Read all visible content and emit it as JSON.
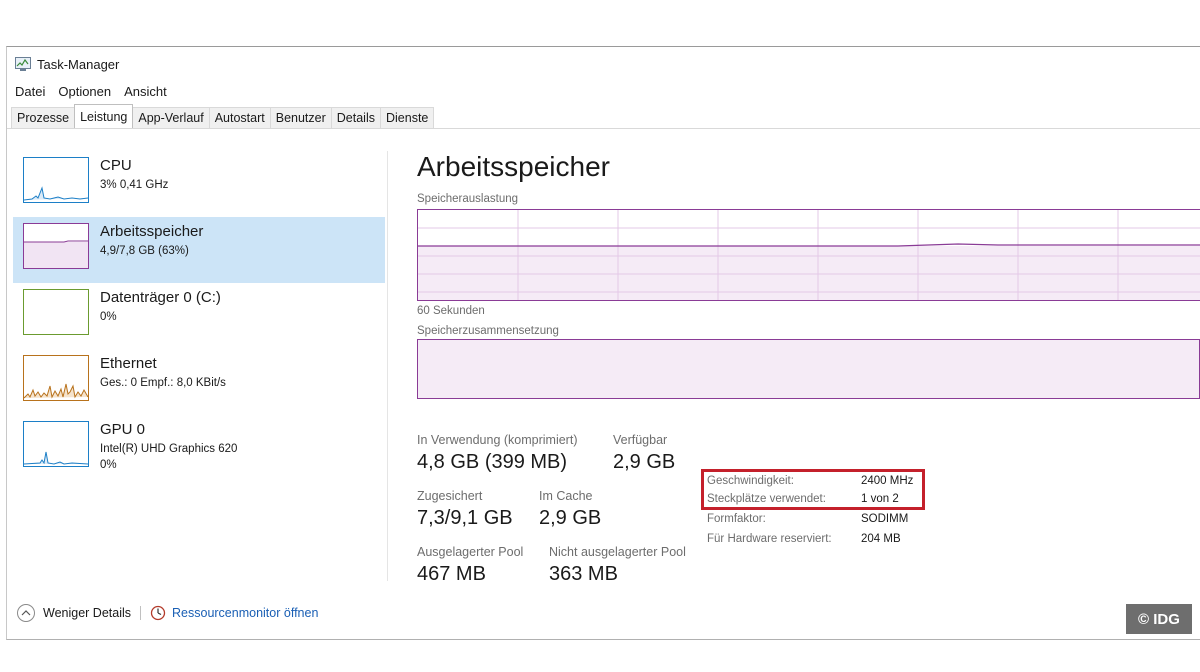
{
  "window": {
    "title": "Task-Manager"
  },
  "menu": [
    "Datei",
    "Optionen",
    "Ansicht"
  ],
  "tabs": [
    {
      "label": "Prozesse",
      "active": false
    },
    {
      "label": "Leistung",
      "active": true
    },
    {
      "label": "App-Verlauf",
      "active": false
    },
    {
      "label": "Autostart",
      "active": false
    },
    {
      "label": "Benutzer",
      "active": false
    },
    {
      "label": "Details",
      "active": false
    },
    {
      "label": "Dienste",
      "active": false
    }
  ],
  "sidebar": {
    "items": [
      {
        "title": "CPU",
        "sub": "3% 0,41 GHz",
        "color": "#1c7fc7",
        "selected": false
      },
      {
        "title": "Arbeitsspeicher",
        "sub": "4,9/7,8 GB (63%)",
        "color": "#8a3b96",
        "selected": true
      },
      {
        "title": "Datenträger 0 (C:)",
        "sub": "0%",
        "color": "#6b9b2f",
        "selected": false
      },
      {
        "title": "Ethernet",
        "sub": "Ges.: 0 Empf.: 8,0 KBit/s",
        "color": "#b8721c",
        "selected": false
      },
      {
        "title": "GPU 0",
        "sub": "Intel(R) UHD Graphics 620",
        "sub2": "0%",
        "color": "#1c7fc7",
        "selected": false
      }
    ]
  },
  "main": {
    "title": "Arbeitsspeicher",
    "usage_label": "Speicherauslastung",
    "time_label": "60 Sekunden",
    "composition_label": "Speicherzusammensetzung",
    "stats": {
      "in_use_label": "In Verwendung (komprimiert)",
      "in_use_value": "4,8 GB (399 MB)",
      "available_label": "Verfügbar",
      "available_value": "2,9 GB",
      "committed_label": "Zugesichert",
      "committed_value": "7,3/9,1 GB",
      "cached_label": "Im Cache",
      "cached_value": "2,9 GB",
      "paged_label": "Ausgelagerter Pool",
      "paged_value": "467 MB",
      "nonpaged_label": "Nicht ausgelagerter Pool",
      "nonpaged_value": "363 MB"
    },
    "details": {
      "speed_label": "Geschwindigkeit:",
      "speed_value": "2400 MHz",
      "slots_label": "Steckplätze verwendet:",
      "slots_value": "1 von 2",
      "form_label": "Formfaktor:",
      "form_value": "SODIMM",
      "reserved_label": "Für Hardware reserviert:",
      "reserved_value": "204 MB"
    }
  },
  "footer": {
    "fewer_details": "Weniger Details",
    "resource_monitor": "Ressourcenmonitor öffnen"
  },
  "watermark": "© IDG",
  "colors": {
    "memory": "#8a3b96",
    "selected_bg": "#cce4f7",
    "highlight": "#c4202b",
    "link": "#1a5fb4"
  }
}
